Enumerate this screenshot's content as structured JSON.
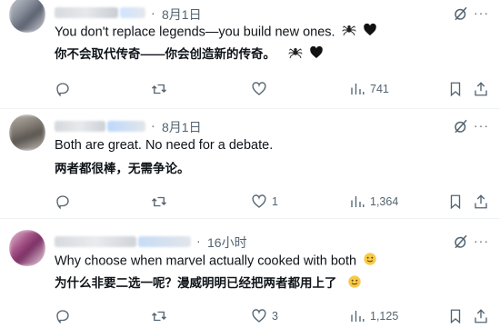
{
  "posts": [
    {
      "time": "8月1日",
      "text_en": "You don't replace legends—you build new ones.",
      "text_zh": "你不会取代传奇——你会创造新的传奇。",
      "emoji": [
        "spider-icon",
        "black-heart-icon"
      ],
      "replies": "",
      "reposts": "",
      "likes": "",
      "views": "741"
    },
    {
      "time": "8月1日",
      "text_en": "Both are great. No need for a debate.",
      "text_zh": "两者都很棒，无需争论。",
      "emoji": [],
      "replies": "",
      "reposts": "",
      "likes": "1",
      "views": "1,364"
    },
    {
      "time": "16小时",
      "text_en": "Why choose when marvel actually cooked with both",
      "text_zh": "为什么非要二选一呢？漫威明明已经把两者都用上了",
      "emoji": [
        "smiling-face-icon"
      ],
      "replies": "",
      "reposts": "",
      "likes": "3",
      "views": "1,125"
    }
  ],
  "separator": "·",
  "more_label": "···"
}
